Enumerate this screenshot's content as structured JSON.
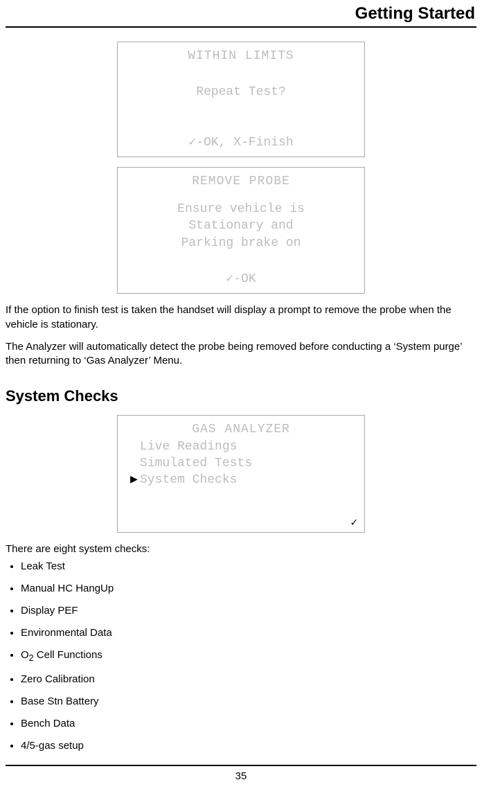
{
  "header": "Getting Started",
  "screen1": {
    "title": "WITHIN LIMITS",
    "line1": "Repeat Test?",
    "footer": "✓-OK, X-Finish"
  },
  "screen2": {
    "title": "REMOVE PROBE",
    "line1": "Ensure vehicle is",
    "line2": "Stationary and",
    "line3": "Parking brake on",
    "footer": "✓-OK"
  },
  "para1": "If the option to finish test is taken the handset will display a prompt to remove the probe when the vehicle is stationary.",
  "para2": "The Analyzer will automatically detect the probe being removed before conducting a ‘System purge’ then returning to ‘Gas Analyzer’ Menu.",
  "section_title": "System Checks",
  "screen3": {
    "title": "GAS ANALYZER",
    "item1": "Live Readings",
    "item2": "Simulated Tests",
    "item3": "System Checks",
    "cursor": "▶",
    "tick": "✓"
  },
  "para3": "There are eight system checks:",
  "checks": {
    "i0": "Leak Test",
    "i1": "Manual HC HangUp",
    "i2": "Display PEF",
    "i3": "Environmental Data",
    "i4_pre": "O",
    "i4_sub": "2",
    "i4_post": " Cell Functions",
    "i5": "Zero Calibration",
    "i6": "Base Stn Battery",
    "i7": "Bench Data",
    "i8": "4/5-gas setup"
  },
  "page_number": "35"
}
